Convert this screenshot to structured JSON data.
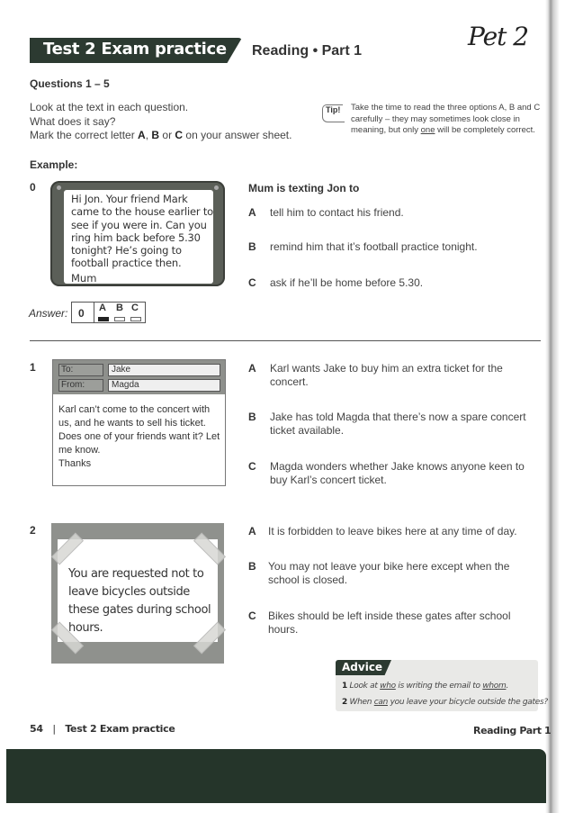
{
  "header": {
    "banner_title": "Test 2  Exam practice",
    "section_title": "Reading • Part 1",
    "handwritten_note": "Pet 2"
  },
  "questions_label": "Questions 1 – 5",
  "instructions": {
    "line1": "Look at the text in each question.",
    "line2": "What does it say?",
    "line3_prefix": "Mark the correct letter ",
    "line3_a": "A",
    "line3_sep1": ", ",
    "line3_b": "B",
    "line3_sep2": " or ",
    "line3_c": "C",
    "line3_suffix": " on your answer sheet."
  },
  "tip": {
    "badge": "Tip!",
    "text_before": "Take the time to read the three options A, B and C carefully – they may sometimes look close in meaning, but only ",
    "text_underlined": "one",
    "text_after": " will be completely correct."
  },
  "example": {
    "label": "Example:",
    "number": "0",
    "message": "Hi Jon. Your friend Mark came to the house earlier to see if you were in. Can you ring him back before 5.30 tonight? He’s going to football practice then.",
    "signature": "Mum",
    "prompt": "Mum is texting Jon to",
    "options": [
      {
        "letter": "A",
        "text": "tell him to contact his friend."
      },
      {
        "letter": "B",
        "text": "remind him that it’s football practice tonight."
      },
      {
        "letter": "C",
        "text": "ask if he’ll be home before 5.30."
      }
    ],
    "answer": {
      "label": "Answer:",
      "question_number": "0",
      "letters": [
        "A",
        "B",
        "C"
      ],
      "selected": "A"
    }
  },
  "questions": [
    {
      "number": "1",
      "type": "email",
      "to_label": "To:",
      "to_value": "Jake",
      "from_label": "From:",
      "from_value": "Magda",
      "body": "Karl can’t come to the concert with us, and he wants to sell his ticket. Does one of your friends want it? Let me know.",
      "closing": "Thanks",
      "options": [
        {
          "letter": "A",
          "text": "Karl wants Jake to buy him an extra ticket for the concert."
        },
        {
          "letter": "B",
          "text": "Jake has told Magda that there’s now a spare concert ticket available."
        },
        {
          "letter": "C",
          "text": "Magda wonders whether Jake knows anyone keen to buy Karl’s concert ticket."
        }
      ]
    },
    {
      "number": "2",
      "type": "notice",
      "notice_text": "You are requested not to leave bicycles outside these gates during school hours.",
      "options": [
        {
          "letter": "A",
          "text": "It is forbidden to leave bikes here at any time of day."
        },
        {
          "letter": "B",
          "text": "You may not leave your bike here except when the school is closed."
        },
        {
          "letter": "C",
          "text": "Bikes should be left inside these gates after school hours."
        }
      ]
    }
  ],
  "advice": {
    "title": "Advice",
    "items": [
      {
        "num": "1",
        "pre": "Look at ",
        "u1": "who",
        "mid": " is writing the email to ",
        "u2": "whom",
        "post": "."
      },
      {
        "num": "2",
        "pre": "When ",
        "u1": "can",
        "mid": " you leave your bicycle outside the gates?",
        "u2": "",
        "post": ""
      }
    ]
  },
  "footer": {
    "page_number": "54",
    "separator": "|",
    "left_title": "Test 2  Exam practice",
    "right_title": "Reading Part 1"
  },
  "colors": {
    "banner_green": "#2c3a31",
    "footer_band": "#25352a"
  }
}
